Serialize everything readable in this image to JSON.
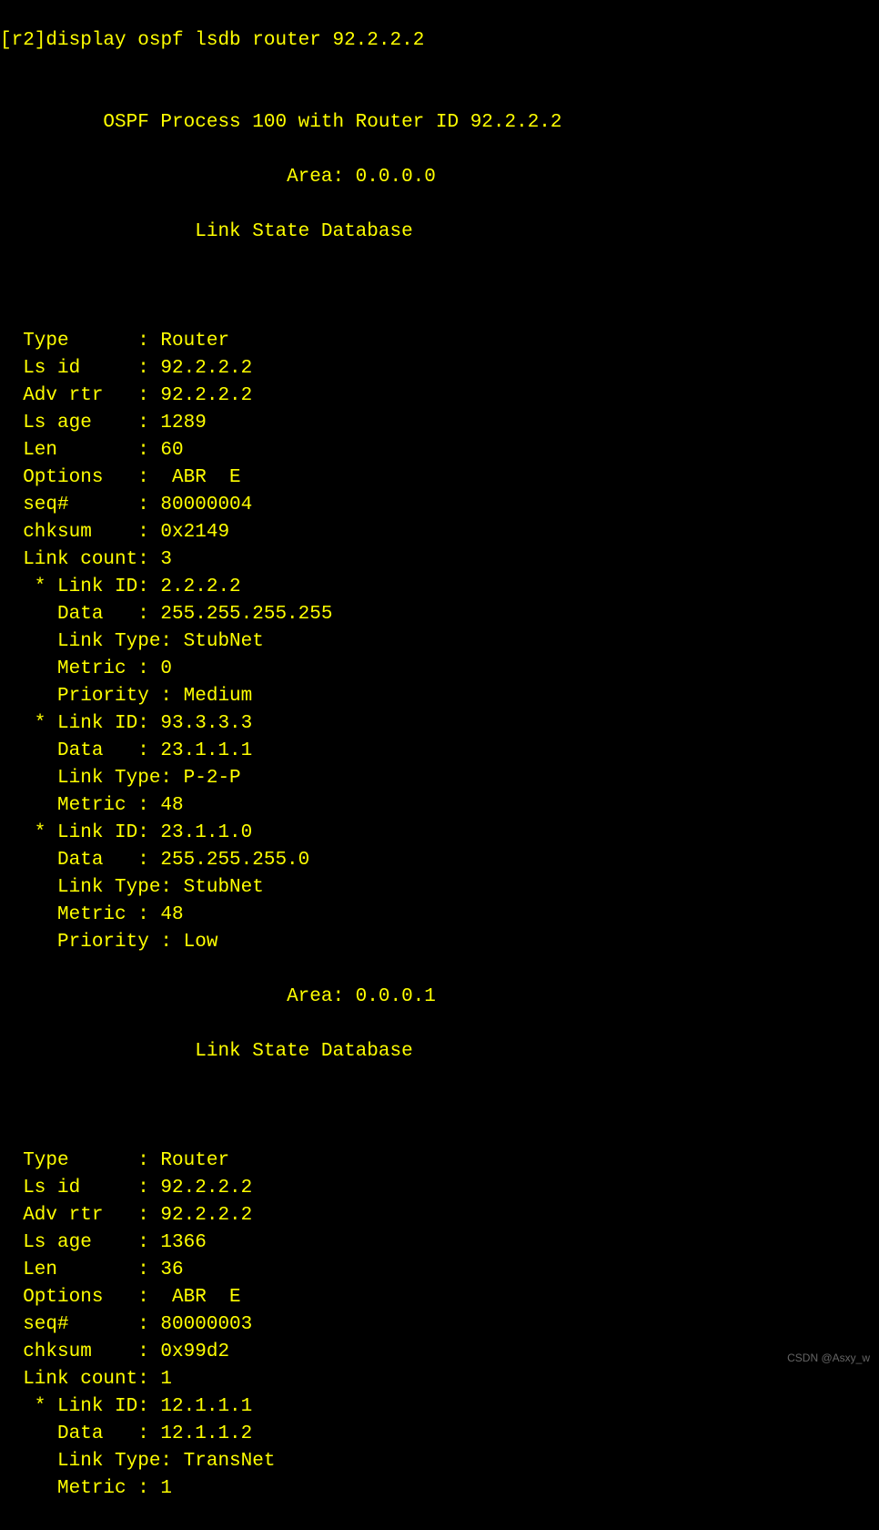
{
  "prompt": {
    "host": "[r2]",
    "command": "display ospf lsdb router 92.2.2.2"
  },
  "header": {
    "process": "OSPF Process 100 with Router ID 92.2.2.2"
  },
  "areas": [
    {
      "area_line": "Area: 0.0.0.0",
      "db_line": "Link State Database",
      "lsa": {
        "fields": [
          {
            "k": "Type      ",
            "v": ": Router"
          },
          {
            "k": "Ls id     ",
            "v": ": 92.2.2.2"
          },
          {
            "k": "Adv rtr   ",
            "v": ": 92.2.2.2"
          },
          {
            "k": "Ls age    ",
            "v": ": 1289"
          },
          {
            "k": "Len       ",
            "v": ": 60"
          },
          {
            "k": "Options   ",
            "v": ":  ABR  E"
          },
          {
            "k": "seq#      ",
            "v": ": 80000004"
          },
          {
            "k": "chksum    ",
            "v": ": 0x2149"
          },
          {
            "k": "Link count",
            "v": ": 3"
          }
        ],
        "links": [
          [
            {
              "txt": "* Link ID: 2.2.2.2"
            },
            {
              "txt": "  Data   : 255.255.255.255"
            },
            {
              "txt": "  Link Type: StubNet"
            },
            {
              "txt": "  Metric : 0"
            },
            {
              "txt": "  Priority : Medium"
            }
          ],
          [
            {
              "txt": "* Link ID: 93.3.3.3"
            },
            {
              "txt": "  Data   : 23.1.1.1"
            },
            {
              "txt": "  Link Type: P-2-P"
            },
            {
              "txt": "  Metric : 48"
            }
          ],
          [
            {
              "txt": "* Link ID: 23.1.1.0"
            },
            {
              "txt": "  Data   : 255.255.255.0"
            },
            {
              "txt": "  Link Type: StubNet"
            },
            {
              "txt": "  Metric : 48"
            },
            {
              "txt": "  Priority : Low"
            }
          ]
        ]
      }
    },
    {
      "area_line": "Area: 0.0.0.1",
      "db_line": "Link State Database",
      "lsa": {
        "fields": [
          {
            "k": "Type      ",
            "v": ": Router"
          },
          {
            "k": "Ls id     ",
            "v": ": 92.2.2.2"
          },
          {
            "k": "Adv rtr   ",
            "v": ": 92.2.2.2"
          },
          {
            "k": "Ls age    ",
            "v": ": 1366"
          },
          {
            "k": "Len       ",
            "v": ": 36"
          },
          {
            "k": "Options   ",
            "v": ":  ABR  E"
          },
          {
            "k": "seq#      ",
            "v": ": 80000003"
          },
          {
            "k": "chksum    ",
            "v": ": 0x99d2"
          },
          {
            "k": "Link count",
            "v": ": 1"
          }
        ],
        "links": [
          [
            {
              "txt": "* Link ID: 12.1.1.1"
            },
            {
              "txt": "  Data   : 12.1.1.2"
            },
            {
              "txt": "  Link Type: TransNet"
            },
            {
              "txt": "  Metric : 1"
            }
          ]
        ]
      }
    }
  ],
  "watermark": "CSDN @Asxy_w"
}
